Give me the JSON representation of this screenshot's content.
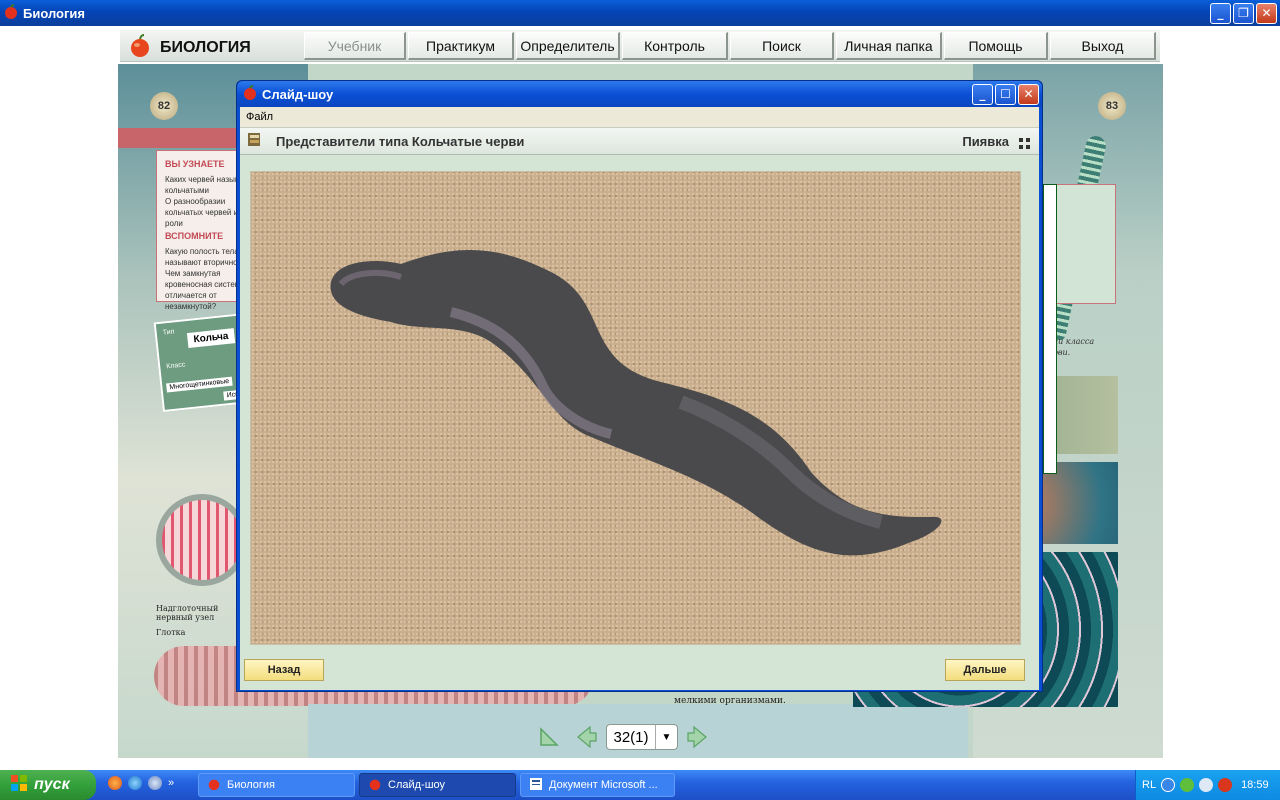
{
  "outer_window": {
    "title": "Биология",
    "minimize": "_",
    "restore": "❐",
    "close": "✕"
  },
  "menubar": {
    "brand": "БИОЛОГИЯ",
    "items": [
      {
        "label": "Учебник",
        "disabled": true
      },
      {
        "label": "Практикум"
      },
      {
        "label": "Определитель"
      },
      {
        "label": "Контроль"
      },
      {
        "label": "Поиск"
      },
      {
        "label": "Личная папка"
      },
      {
        "label": "Помощь"
      },
      {
        "label": "Выход"
      }
    ]
  },
  "book": {
    "page_left": "82",
    "page_right": "83",
    "learn_heading": "ВЫ УЗНАЕТЕ",
    "learn_items": [
      "Каких червей называют кольчатыми",
      "О разнообразии кольчатых червей и их роли"
    ],
    "remember_heading": "ВСПОМНИТЕ",
    "remember_items": [
      "Какую полость тела называют вторичной?",
      "Чем замкнутая кровеносная система отличается от незамкнутой?"
    ],
    "card_label": "Кольча",
    "card_lines": [
      "Тип",
      "Класс",
      "Многощетинковые",
      "Иско"
    ],
    "diagram_labels": [
      "Надглоточный нервный узел",
      "Глотка"
    ],
    "bottom_text": "мелкими организмами.",
    "right_text": [
      "нели класса",
      "черви."
    ]
  },
  "nav": {
    "page": "32(1)",
    "first_icon": "first-page-icon",
    "prev_icon": "prev-page-icon",
    "next_icon": "next-page-icon"
  },
  "slide_window": {
    "title": "Слайд-шоу",
    "file_menu": "Файл",
    "header_title": "Представители типа Кольчатые черви",
    "header_right": "Пиявка",
    "back_button": "Назад",
    "next_button": "Дальше"
  },
  "taskbar": {
    "start": "пуск",
    "tasks": [
      {
        "label": "Биология",
        "active": false
      },
      {
        "label": "Слайд-шоу",
        "active": true
      },
      {
        "label": "Документ Microsoft ...",
        "active": false
      }
    ],
    "lang": "RL",
    "clock": "18:59",
    "quicklaunch_more": "»"
  },
  "colors": {
    "xp_blue": "#0a50d6",
    "slide_bg": "#d4e5d6",
    "button_yellow": "#f3dd7d",
    "start_green": "#33a03a"
  }
}
